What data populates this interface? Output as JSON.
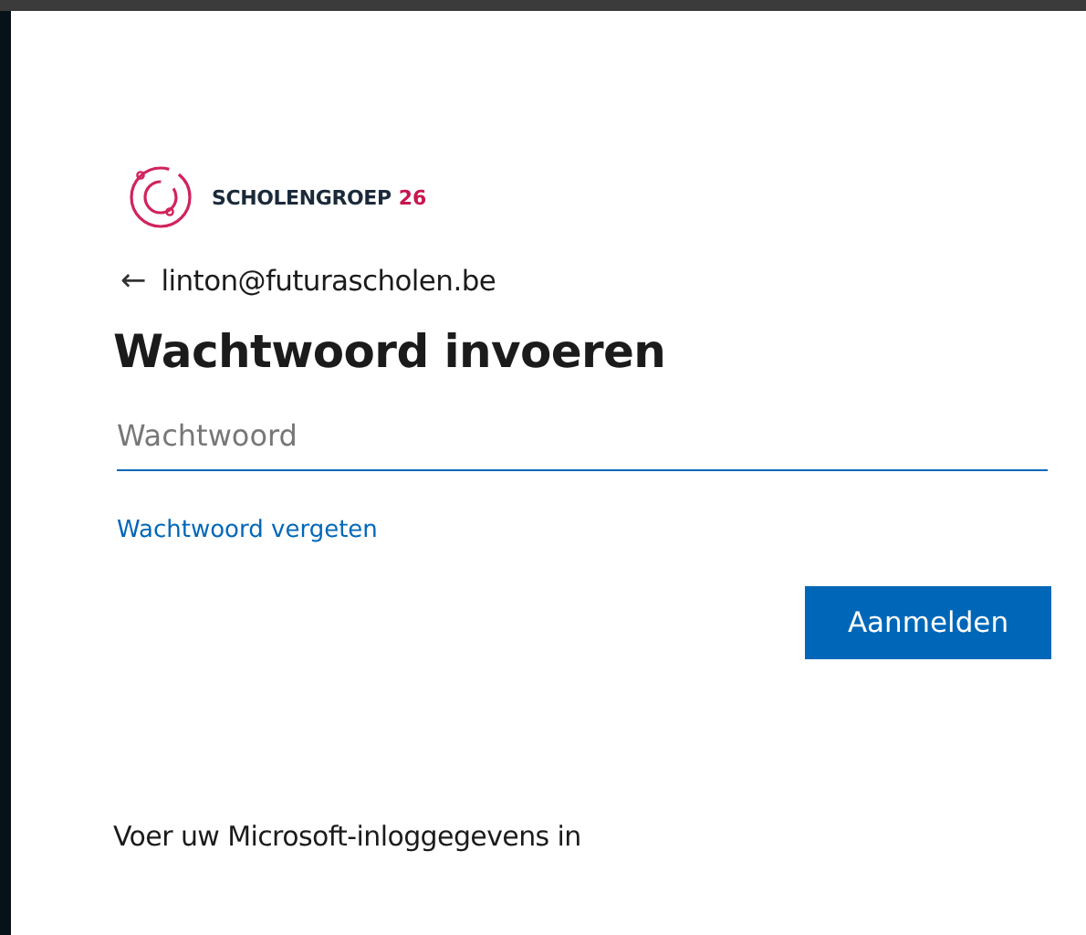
{
  "logo": {
    "name": "SCHOLENGROEP",
    "number": "26"
  },
  "account": {
    "back_icon": "←",
    "email": "linton@futurascholen.be"
  },
  "title": "Wachtwoord invoeren",
  "password": {
    "placeholder": "Wachtwoord",
    "focused": true
  },
  "forgot_link": "Wachtwoord vergeten",
  "buttons": [
    "Aanmelden"
  ],
  "footer": "Voer uw Microsoft-inloggegevens in"
}
